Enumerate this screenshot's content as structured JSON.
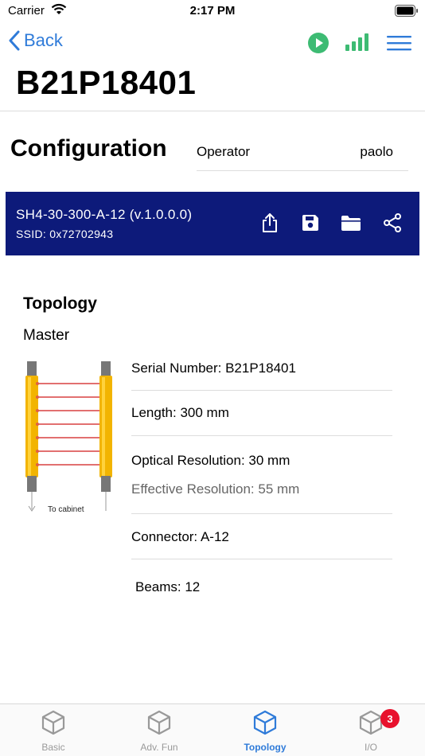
{
  "status_bar": {
    "carrier": "Carrier",
    "time": "2:17 PM"
  },
  "nav": {
    "back_label": "Back",
    "play_color": "#3dbb73",
    "signal_color": "#3dbb73",
    "accent": "#2f7bd9"
  },
  "device": {
    "serial_title": "B21P18401"
  },
  "config": {
    "title": "Configuration",
    "operator_label": "Operator",
    "operator_value": "paolo"
  },
  "banner": {
    "model": "SH4-30-300-A-12 (v.1.0.0.0)",
    "ssid": "SSID: 0x72702943",
    "background": "#0d1a7a",
    "actions": [
      "share-icon",
      "save-icon",
      "folder-icon",
      "network-share-icon"
    ]
  },
  "topology": {
    "title": "Topology",
    "mode": "Master",
    "cabinet_label": "To cabinet",
    "serial_number": "Serial Number: B21P18401",
    "length": "Length: 300 mm",
    "optical_resolution": "Optical Resolution: 30 mm",
    "effective_resolution": "Effective Resolution: 55 mm",
    "connector": "Connector: A-12",
    "beams": "Beams: 12"
  },
  "tabs": [
    {
      "label": "Basic",
      "active": false
    },
    {
      "label": "Adv. Fun",
      "active": false
    },
    {
      "label": "Topology",
      "active": true
    },
    {
      "label": "I/O",
      "active": false,
      "badge": "3"
    }
  ]
}
